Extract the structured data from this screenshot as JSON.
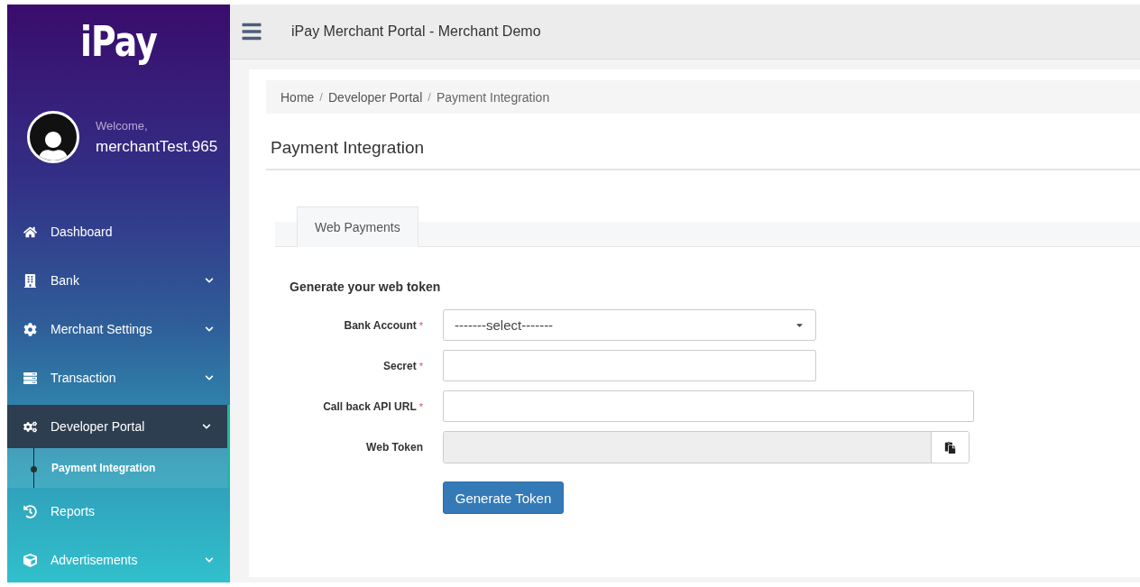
{
  "logo": "iPay",
  "user": {
    "greeting": "Welcome,",
    "name": "merchantTest.965"
  },
  "sidebar": {
    "items": [
      {
        "label": "Dashboard",
        "has_submenu": false,
        "selected": false
      },
      {
        "label": "Bank",
        "has_submenu": true,
        "selected": false
      },
      {
        "label": "Merchant Settings",
        "has_submenu": true,
        "selected": false
      },
      {
        "label": "Transaction",
        "has_submenu": true,
        "selected": false
      },
      {
        "label": "Developer Portal",
        "has_submenu": true,
        "selected": true,
        "expanded": true,
        "children": [
          {
            "label": "Payment Integration",
            "selected": true
          }
        ]
      },
      {
        "label": "Reports",
        "has_submenu": false,
        "selected": false
      },
      {
        "label": "Advertisements",
        "has_submenu": true,
        "selected": false
      }
    ]
  },
  "topbar": {
    "title": "iPay Merchant Portal - Merchant Demo"
  },
  "breadcrumb": [
    {
      "label": "Home"
    },
    {
      "separator": "/",
      "label": "Developer Portal"
    },
    {
      "separator": "/",
      "label": "Payment Integration"
    }
  ],
  "page_title": "Payment Integration",
  "tabs": [
    {
      "label": "Web Payments",
      "selected": true
    }
  ],
  "form": {
    "heading": "Generate your web token",
    "fields": [
      {
        "kind": "select",
        "label": "Bank Account",
        "required_mark": "*",
        "value": "-------select-------"
      },
      {
        "kind": "text",
        "label": "Secret",
        "required_mark": "*"
      },
      {
        "kind": "url",
        "label": "Call back API URL",
        "required_mark": "*"
      },
      {
        "kind": "readonly-copy",
        "label": "Web Token"
      }
    ],
    "submit": "Generate Token"
  }
}
